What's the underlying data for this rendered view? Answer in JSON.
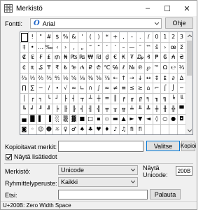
{
  "window": {
    "title": "Merkistö",
    "minimize_glyph": "–",
    "maximize_glyph": "☐",
    "close_glyph": "✕",
    "icon": "charmap-app-icon"
  },
  "font": {
    "label": "Fontti:",
    "value": "Arial",
    "icon": "opentype-font-icon",
    "help_button": "Ohje"
  },
  "characters": [
    "",
    "!",
    "\"",
    "#",
    "$",
    "%",
    "&",
    "'",
    "(",
    ")",
    "*",
    "+",
    ",",
    "-",
    ".",
    "/",
    "0",
    "1",
    "2",
    "3",
    "‡",
    "•",
    "…",
    "‰",
    "‹",
    "›",
    "‚",
    "„",
    "“",
    "”",
    "‘",
    "’",
    "–",
    "—",
    "˜",
    "™",
    "š",
    "›",
    "œ",
    "ž",
    "₡",
    "₢",
    "₣",
    "₤",
    "₥",
    "₦",
    "₧",
    "₨",
    "₩",
    "₪",
    "₫",
    "€",
    "₭",
    "₮",
    "₯",
    "₰",
    "₱",
    "₲",
    "₳",
    "₴",
    "₵",
    "₶",
    "₷",
    "₸",
    "₹",
    "₺",
    "₻",
    "₼",
    "₽",
    "₾",
    "℃",
    "℅",
    "ℓ",
    "№",
    "℗",
    "℘",
    "™",
    "Ω",
    "℮",
    "⅓",
    "⅔",
    "⅕",
    "⅖",
    "⅗",
    "⅘",
    "⅙",
    "⅚",
    "⅛",
    "⅜",
    "⅝",
    "⅞",
    "←",
    "↑",
    "→",
    "↓",
    "↔",
    "↕",
    "↨",
    "∂",
    "∆",
    "∏",
    "∑",
    "−",
    "∕",
    "∙",
    "√",
    "∞",
    "∟",
    "∩",
    "∫",
    "≈",
    "≠",
    "≡",
    "≤",
    "≥",
    "⌂",
    "⌐",
    "⌠",
    "⌡",
    "─",
    "│",
    "┌",
    "┐",
    "└",
    "┘",
    "├",
    "┤",
    "┬",
    "┴",
    "┼",
    "═",
    "║",
    "╒",
    "╓",
    "╔",
    "╕",
    "╖",
    "╗",
    "╘",
    "╙",
    "╚",
    "╛",
    "╜",
    "╝",
    "╞",
    "╟",
    "╠",
    "╡",
    "╢",
    "╣",
    "╤",
    "╥",
    "╦",
    "╧",
    "╨",
    "╩",
    "╪",
    "╫",
    "╬",
    "▀",
    "▄",
    "█",
    "▌",
    "▐",
    "░",
    "▒",
    "▓",
    "■",
    "□",
    "▪",
    "▫",
    "▬",
    "▲",
    "►",
    "▼",
    "◄",
    "◊",
    "○",
    "●",
    "◘",
    "◙",
    "◦",
    "☺",
    "☻",
    "☼",
    "♀",
    "♂",
    "♠",
    "♣",
    "♥",
    "♦",
    "♪",
    "♫",
    "ﬁ",
    "ﬂ",
    "",
    "",
    "",
    "",
    ""
  ],
  "copy": {
    "label": "Kopioitavat merkit:",
    "value": "",
    "select_button": "Valitse",
    "copy_button": "Kopioi"
  },
  "advanced": {
    "checkbox_label": "Näytä lisätiedot",
    "checked": true,
    "charset_label": "Merkistö:",
    "charset_value": "Unicode",
    "unicode_goto_label_1": "Näytä",
    "unicode_goto_label_2": "Unicode:",
    "unicode_goto_value": "200B",
    "group_label": "Ryhmittelyperuste:",
    "group_value": "Kaikki",
    "search_label": "Etsi:",
    "search_value": "",
    "search_button": "Palauta"
  },
  "status": {
    "text": "U+200B: Zero Width Space"
  }
}
